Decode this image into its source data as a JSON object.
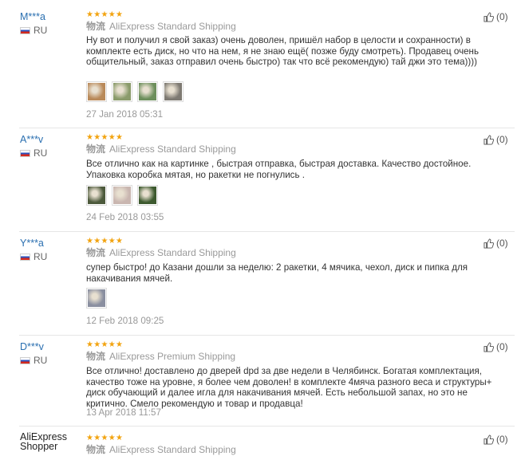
{
  "reviews": [
    {
      "user": "M***a",
      "country": "RU",
      "stars": "★★★★★",
      "ship_label": "物流",
      "shipping": "AliExpress Standard Shipping",
      "text": "Ну вот и получил я свой заказ) очень доволен, пришёл набор в целости и сохранности) в комплекте есть диск, но что на нем, я не знаю ещё( позже буду смотреть). Продавец очень общительный, заказ отправил очень быстро) так что всё рекомендую) тай джи это тема))))",
      "photos": [
        "#b98a5a",
        "#8a9b6b",
        "#6d8f5c",
        "#7e7a72"
      ],
      "date": "27 Jan 2018 05:31",
      "likes": "(0)"
    },
    {
      "user": "A***v",
      "country": "RU",
      "stars": "★★★★★",
      "ship_label": "物流",
      "shipping": "AliExpress Standard Shipping",
      "text": "Все отлично как на картинке , быстрая отправка, быстрая доставка. Качество достойное. Упаковка коробка мятая, но ракетки не погнулись .",
      "photos": [
        "#4d5a3c",
        "#c9b6b0",
        "#3d5a2f"
      ],
      "date": "24 Feb 2018 03:55",
      "likes": "(0)"
    },
    {
      "user": "Y***a",
      "country": "RU",
      "stars": "★★★★★",
      "ship_label": "物流",
      "shipping": "AliExpress Standard Shipping",
      "text": "супер быстро! до Казани дошли за неделю: 2 ракетки, 4 мячика, чехол, диск и пипка для накачивания мячей.",
      "photos": [
        "#8a8fa0"
      ],
      "date": "12 Feb 2018 09:25",
      "likes": "(0)"
    },
    {
      "user": "D***v",
      "country": "RU",
      "stars": "★★★★★",
      "ship_label": "物流",
      "shipping": "AliExpress Premium Shipping",
      "text": "Все отлично! доставлено до дверей dpd за две недели в Челябинск. Богатая комплектация, качество тоже на уровне, я более чем доволен! в комплекте 4мяча разного веса и структуры+ диск обучающий и далее игла для накачивания мячей. Есть небольшой запах, но это не критично. Смело рекомендую и товар и продавца!",
      "photos": [],
      "date": "13 Apr 2018 11:57",
      "likes": "(0)"
    },
    {
      "user": "AliExpress Shopper",
      "country": "",
      "stars": "★★★★★",
      "ship_label": "物流",
      "shipping": "AliExpress Standard Shipping",
      "text": "",
      "photos": [],
      "date": "",
      "likes": "(0)"
    }
  ]
}
